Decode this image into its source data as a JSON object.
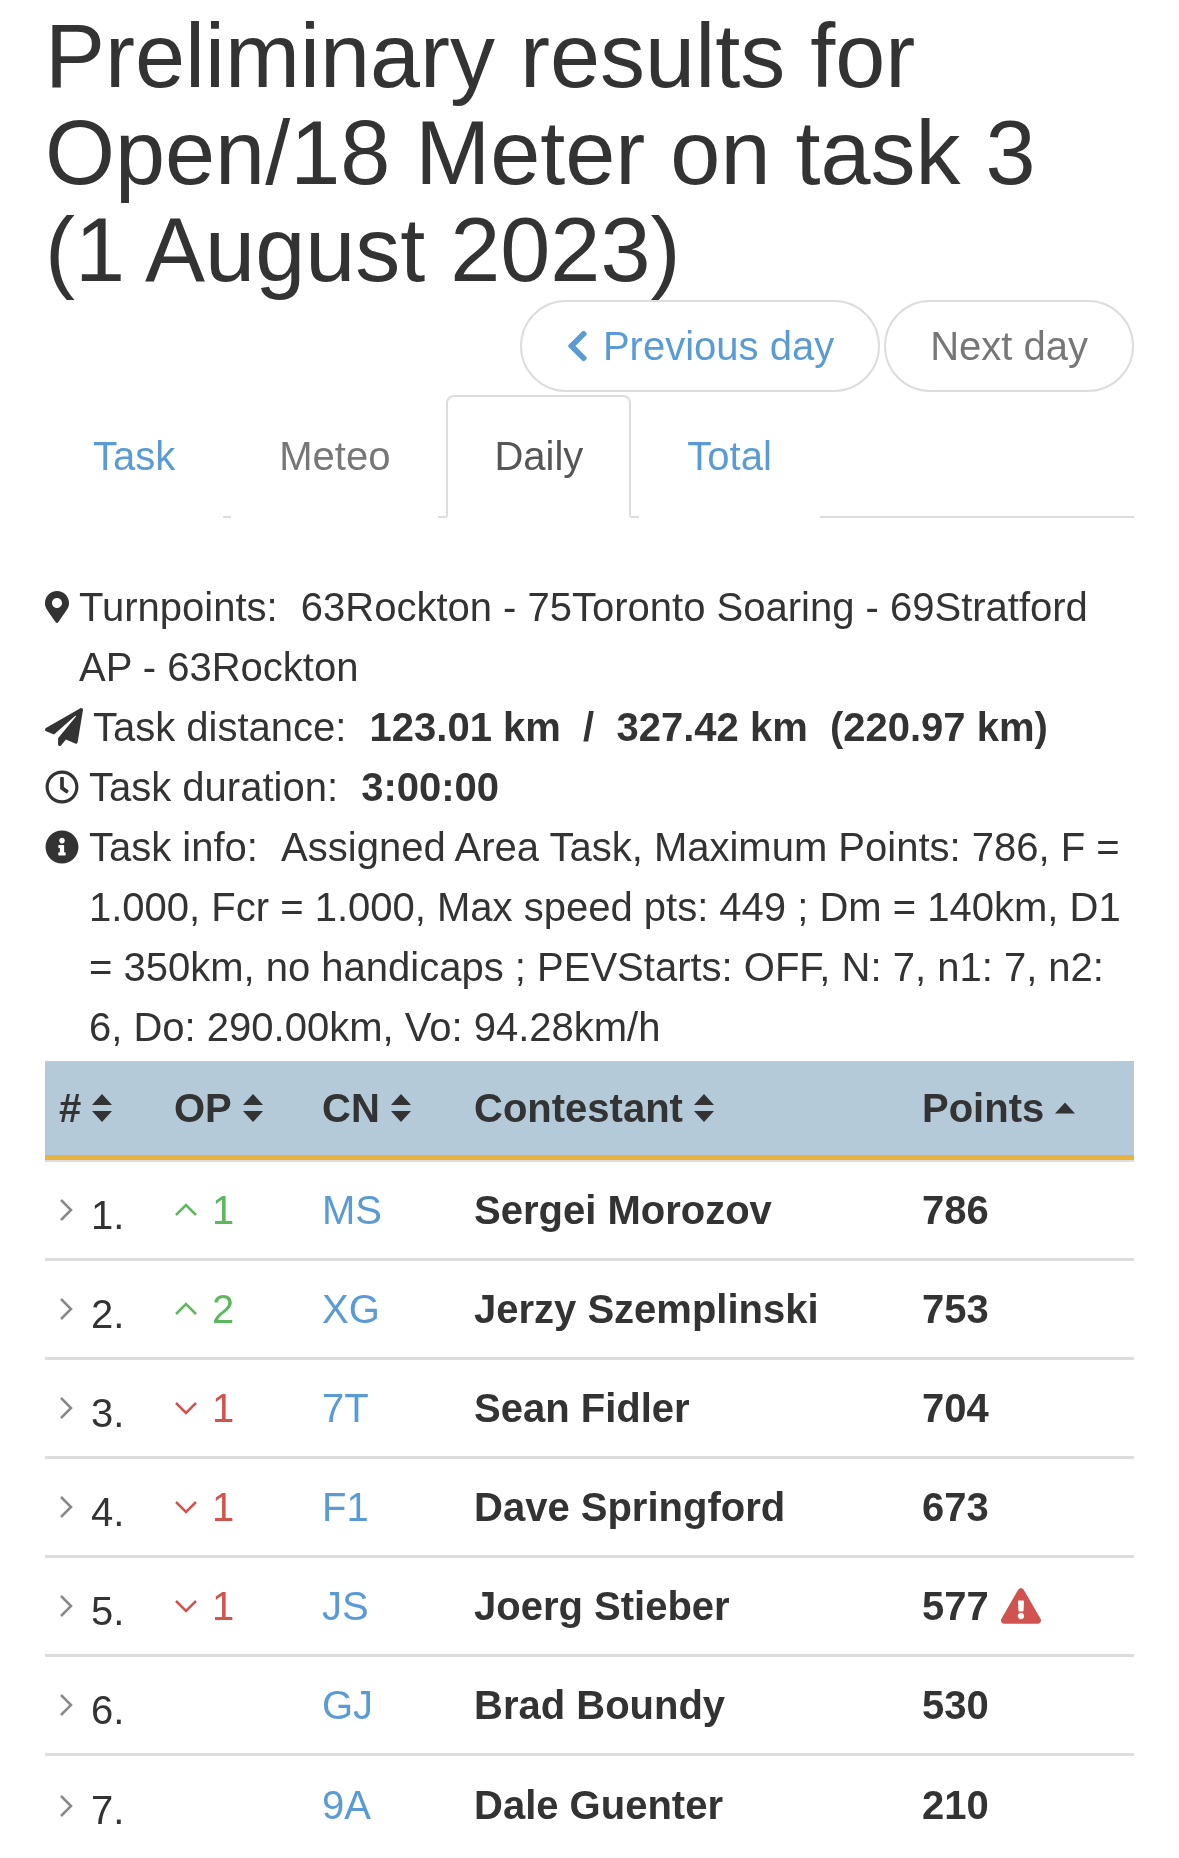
{
  "title": "Preliminary results for Open/18 Meter on task 3 (1 August 2023)",
  "day_nav": [
    {
      "kind": "previous",
      "label": "Previous day",
      "disabled": false
    },
    {
      "kind": "next",
      "label": "Next day",
      "disabled": true
    }
  ],
  "tabs": [
    {
      "label": "Task",
      "selected": false,
      "disabled": false
    },
    {
      "label": "Meteo",
      "selected": false,
      "disabled": true
    },
    {
      "label": "Daily",
      "selected": true,
      "disabled": false
    },
    {
      "label": "Total",
      "selected": false,
      "disabled": false
    }
  ],
  "task_details": [
    {
      "kind": "turnpoints",
      "label": "Turnpoints:",
      "value": "63Rockton - 75Toronto Soaring - 69Stratford AP - 63Rockton"
    },
    {
      "kind": "distance",
      "label": "Task distance:",
      "value": "123.01 km  /  327.42 km  (220.97 km)"
    },
    {
      "kind": "duration",
      "label": "Task duration:",
      "value": "3:00:00"
    },
    {
      "kind": "info",
      "label": "Task info:",
      "value": "Assigned Area Task, Maximum Points: 786, F = 1.000, Fcr = 1.000, Max speed pts: 449 ; Dm = 140km, D1 = 350km, no handicaps ; PEVStarts: OFF, N: 7, n1: 7, n2: 6, Do: 290.00km, Vo: 94.28km/h"
    }
  ],
  "results_table": {
    "columns": [
      {
        "label": "#",
        "sorted": false
      },
      {
        "label": "OP",
        "sorted": false
      },
      {
        "label": "CN",
        "sorted": false
      },
      {
        "label": "Contestant",
        "sorted": false
      },
      {
        "label": "Points",
        "sorted": true
      }
    ],
    "rows": [
      {
        "expanded": false,
        "rank": "1.",
        "op_change": {
          "up": true,
          "value": "1"
        },
        "cn": "MS",
        "contestant": "Sergei Morozov",
        "points": "786",
        "warning": false
      },
      {
        "expanded": false,
        "rank": "2.",
        "op_change": {
          "up": true,
          "value": "2"
        },
        "cn": "XG",
        "contestant": "Jerzy Szemplinski",
        "points": "753",
        "warning": false
      },
      {
        "expanded": false,
        "rank": "3.",
        "op_change": {
          "up": false,
          "value": "1"
        },
        "cn": "7T",
        "contestant": "Sean Fidler",
        "points": "704",
        "warning": false
      },
      {
        "expanded": false,
        "rank": "4.",
        "op_change": {
          "up": false,
          "value": "1"
        },
        "cn": "F1",
        "contestant": "Dave Springford",
        "points": "673",
        "warning": false
      },
      {
        "expanded": false,
        "rank": "5.",
        "op_change": {
          "up": false,
          "value": "1"
        },
        "cn": "JS",
        "contestant": "Joerg Stieber",
        "points": "577",
        "warning": true
      },
      {
        "expanded": false,
        "rank": "6.",
        "cn": "GJ",
        "contestant": "Brad Boundy",
        "points": "530",
        "warning": false
      },
      {
        "expanded": false,
        "rank": "7.",
        "cn": "9A",
        "contestant": "Dale Guenter",
        "points": "210",
        "warning": false
      }
    ]
  }
}
